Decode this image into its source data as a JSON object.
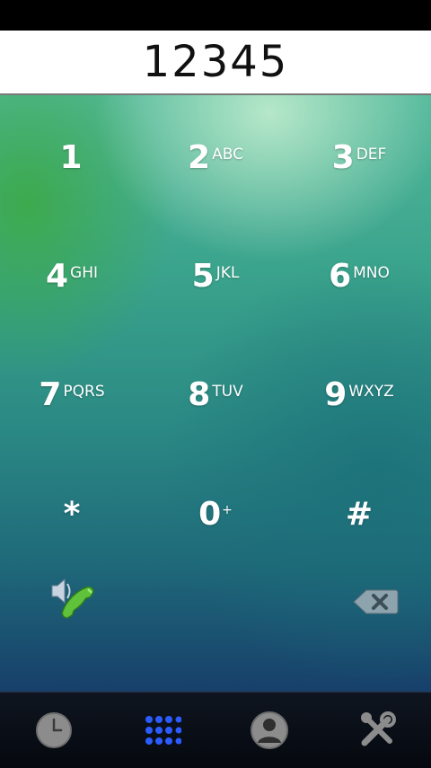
{
  "dialer": {
    "number": "12345"
  },
  "keys": [
    {
      "digit": "1",
      "letters": ""
    },
    {
      "digit": "2",
      "letters": "ABC"
    },
    {
      "digit": "3",
      "letters": "DEF"
    },
    {
      "digit": "4",
      "letters": "GHI"
    },
    {
      "digit": "5",
      "letters": "JKL"
    },
    {
      "digit": "6",
      "letters": "MNO"
    },
    {
      "digit": "7",
      "letters": "PQRS"
    },
    {
      "digit": "8",
      "letters": "TUV"
    },
    {
      "digit": "9",
      "letters": "WXYZ"
    },
    {
      "digit": "*",
      "letters": ""
    },
    {
      "digit": "0",
      "letters": "+"
    },
    {
      "digit": "#",
      "letters": ""
    }
  ],
  "actions": {
    "call_icon": "speaker-phone-icon",
    "backspace_icon": "backspace-icon"
  },
  "nav": [
    {
      "icon": "clock-icon",
      "active": false
    },
    {
      "icon": "dialpad-grid-icon",
      "active": true
    },
    {
      "icon": "contact-icon",
      "active": false
    },
    {
      "icon": "tools-icon",
      "active": false
    }
  ],
  "colors": {
    "accent": "#2a5cff",
    "call_green": "#5fc23a"
  }
}
